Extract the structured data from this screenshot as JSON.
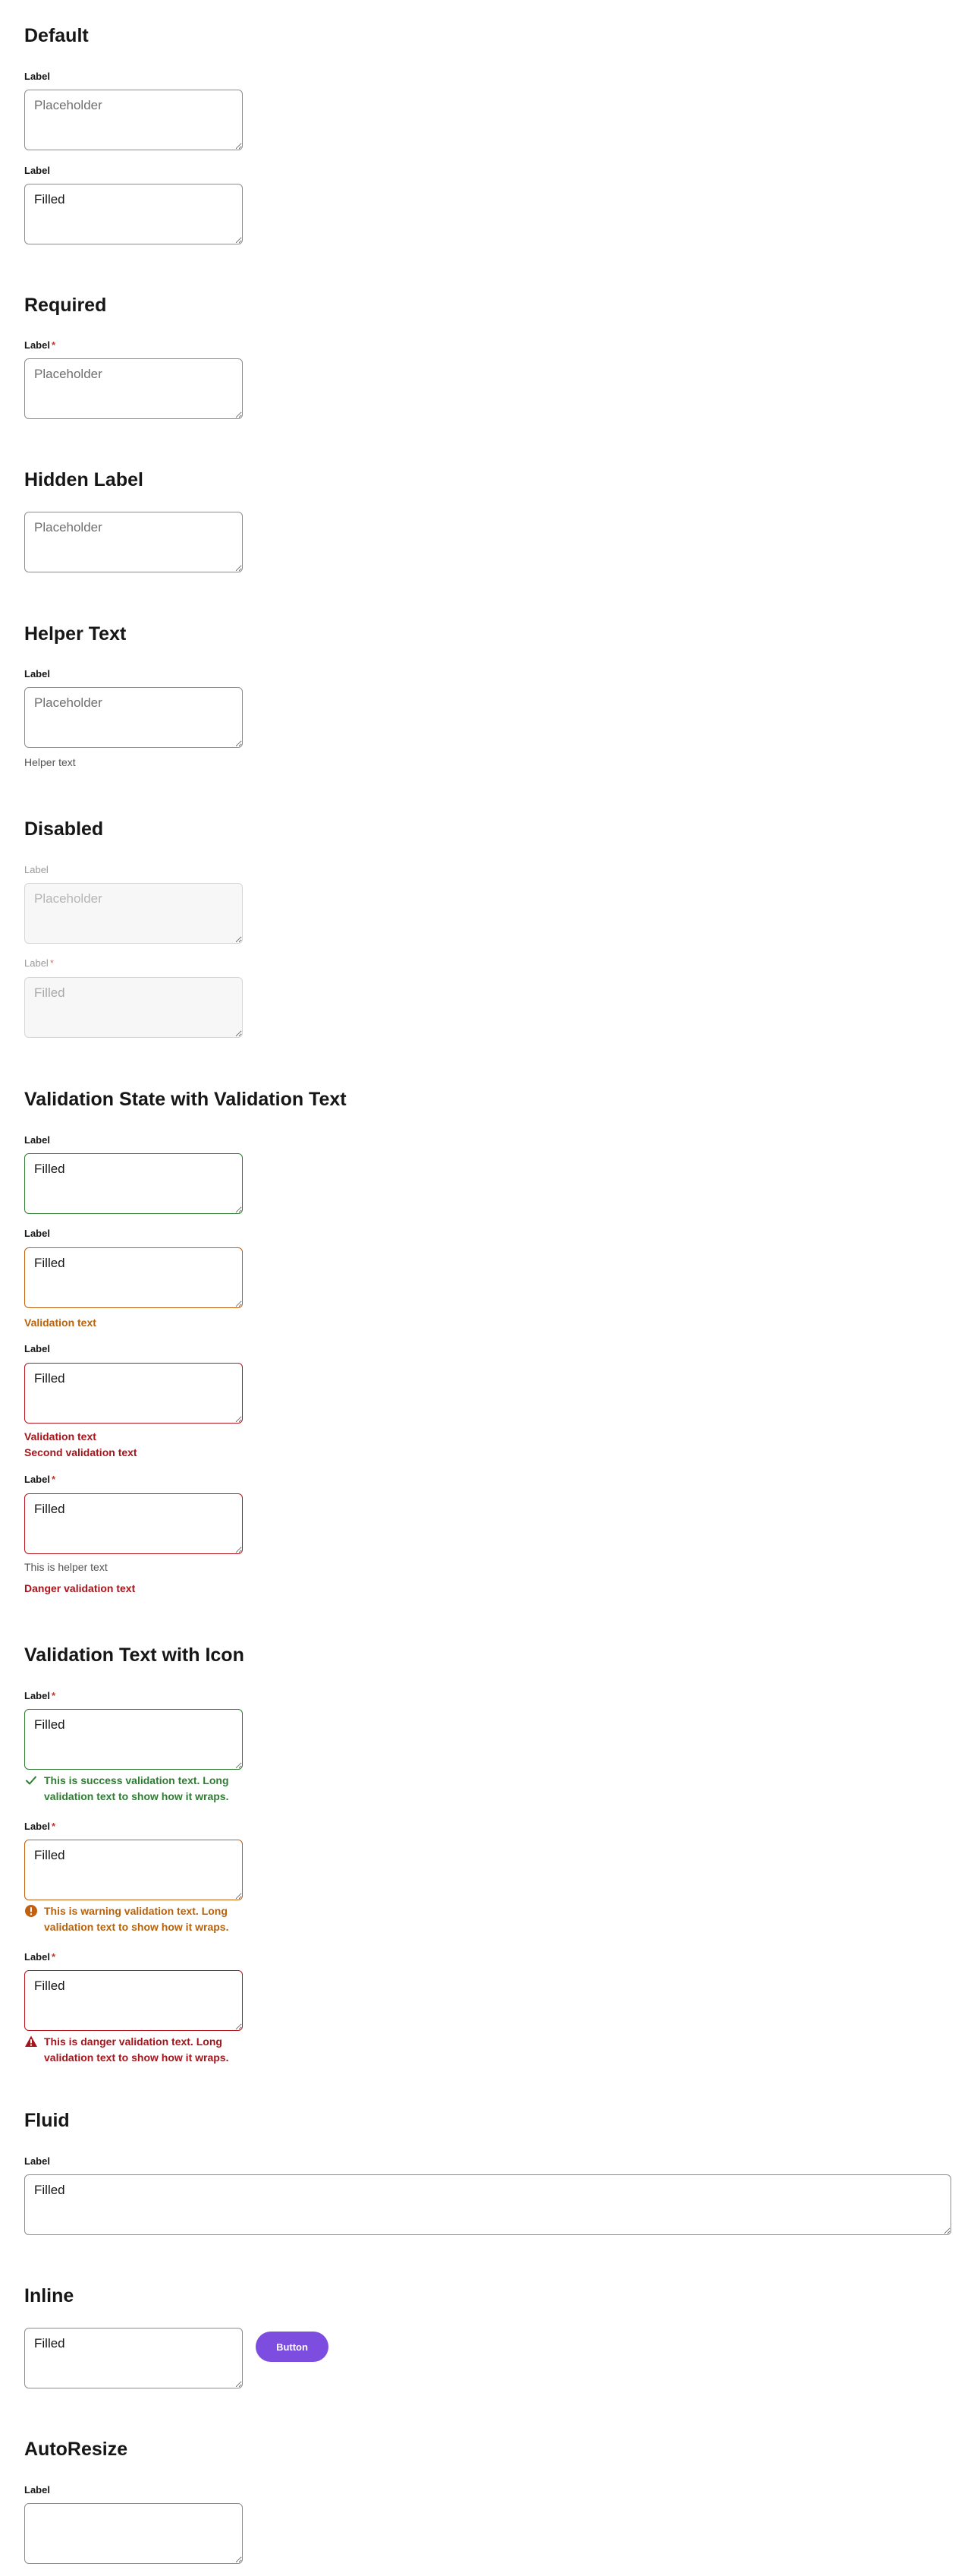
{
  "sections": {
    "default": {
      "title": "Default",
      "label1": "Label",
      "placeholder1": "Placeholder",
      "label2": "Label",
      "value2": "Filled"
    },
    "required": {
      "title": "Required",
      "label": "Label",
      "required_mark": "*",
      "placeholder": "Placeholder"
    },
    "hidden_label": {
      "title": "Hidden Label",
      "placeholder": "Placeholder"
    },
    "helper_text": {
      "title": "Helper Text",
      "label": "Label",
      "placeholder": "Placeholder",
      "helper": "Helper text"
    },
    "disabled": {
      "title": "Disabled",
      "label1": "Label",
      "placeholder1": "Placeholder",
      "label2": "Label",
      "required_mark": "*",
      "value2": "Filled"
    },
    "validation_state": {
      "title": "Validation State with Validation Text",
      "success": {
        "label": "Label",
        "value": "Filled"
      },
      "warning": {
        "label": "Label",
        "value": "Filled",
        "validation": "Validation text"
      },
      "danger": {
        "label": "Label",
        "value": "Filled",
        "validation1": "Validation text",
        "validation2": "Second validation text"
      },
      "danger_required": {
        "label": "Label",
        "required_mark": "*",
        "value": "Filled",
        "helper": "This is helper text",
        "validation": "Danger validation text"
      }
    },
    "validation_icon": {
      "title": "Validation Text with Icon",
      "success": {
        "label": "Label",
        "required_mark": "*",
        "value": "Filled",
        "icon": "checkmark-icon",
        "text": "This is success validation text. Long validation text to show how it wraps."
      },
      "warning": {
        "label": "Label",
        "required_mark": "*",
        "value": "Filled",
        "icon": "warning-circle-icon",
        "text": "This is warning validation text. Long validation text to show how it wraps."
      },
      "danger": {
        "label": "Label",
        "required_mark": "*",
        "value": "Filled",
        "icon": "danger-triangle-icon",
        "text": "This is danger validation text. Long validation text to show how it wraps."
      }
    },
    "fluid": {
      "title": "Fluid",
      "label": "Label",
      "value": "Filled"
    },
    "inline": {
      "title": "Inline",
      "value": "Filled",
      "button": "Button"
    },
    "autoresize": {
      "title": "AutoResize",
      "label": "Label",
      "value": ""
    }
  },
  "colors": {
    "success": "#2e7d32",
    "warning": "#c06010",
    "danger": "#b5161f",
    "required": "#c0392b",
    "button": "#7c4ddf"
  }
}
